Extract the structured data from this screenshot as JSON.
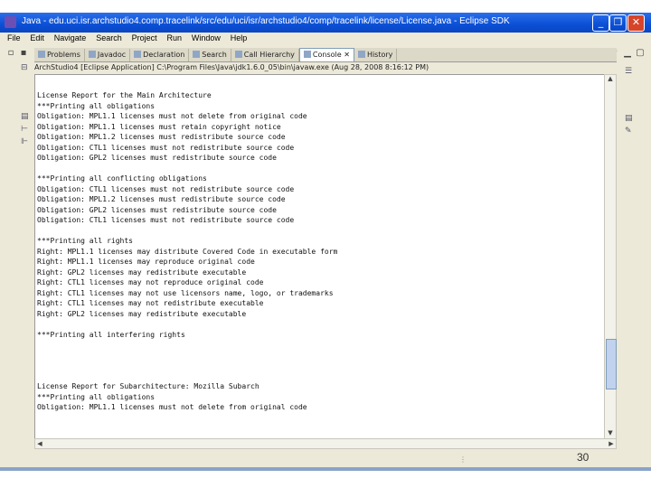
{
  "window": {
    "title": "Java - edu.uci.isr.archstudio4.comp.tracelink/src/edu/uci/isr/archstudio4/comp/tracelink/license/License.java - Eclipse SDK",
    "minimize": "_",
    "maximize": "❐",
    "close": "✕"
  },
  "menu": [
    "File",
    "Edit",
    "Navigate",
    "Search",
    "Project",
    "Run",
    "Window",
    "Help"
  ],
  "tabs": [
    {
      "label": "Problems"
    },
    {
      "label": "Javadoc"
    },
    {
      "label": "Declaration"
    },
    {
      "label": "Search"
    },
    {
      "label": "Call Hierarchy"
    },
    {
      "label": "Console ✕"
    },
    {
      "label": "History"
    }
  ],
  "console": {
    "path": "ArchStudio4 [Eclipse Application] C:\\Program Files\\Java\\jdk1.6.0_05\\bin\\javaw.exe (Aug 28, 2008 8:16:12 PM)",
    "lines": [
      "License Report for the Main Architecture",
      "***Printing all obligations",
      "Obligation: MPL1.1 licenses must not delete from original code",
      "Obligation: MPL1.1 licenses must retain copyright notice",
      "Obligation: MPL1.2 licenses must redistribute source code",
      "Obligation: CTL1 licenses must not redistribute source code",
      "Obligation: GPL2 licenses must redistribute source code",
      "",
      "***Printing all conflicting obligations",
      "Obligation: CTL1 licenses must not redistribute source code",
      "Obligation: MPL1.2 licenses must redistribute source code",
      "Obligation: GPL2 licenses must redistribute source code",
      "Obligation: CTL1 licenses must not redistribute source code",
      "",
      "***Printing all rights",
      "Right: MPL1.1 licenses may distribute Covered Code in executable form",
      "Right: MPL1.1 licenses may reproduce original code",
      "Right: GPL2 licenses may redistribute executable",
      "Right: CTL1 licenses may not reproduce original code",
      "Right: CTL1 licenses may not use licensors name, logo, or trademarks",
      "Right: CTL1 licenses may not redistribute executable",
      "Right: GPL2 licenses may redistribute executable",
      "",
      "***Printing all interfering rights",
      "",
      "",
      "",
      "",
      "License Report for Subarchitecture: Mozilla Subarch",
      "***Printing all obligations",
      "Obligation: MPL1.1 licenses must not delete from original code"
    ]
  },
  "page_number": "30",
  "status_dots": "⋮"
}
